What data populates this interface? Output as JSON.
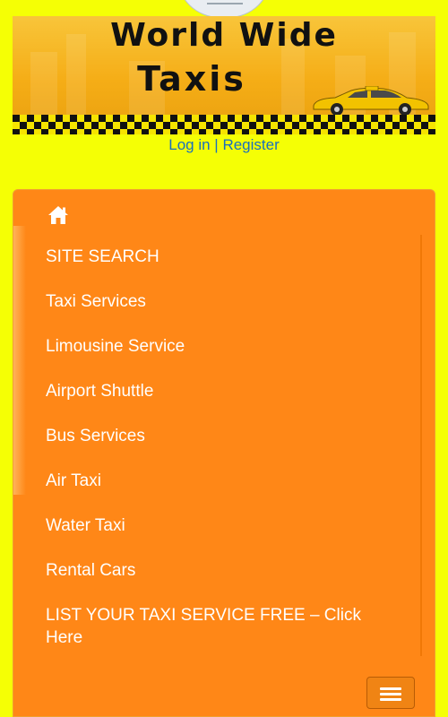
{
  "header": {
    "logo_line1": "World Wide",
    "logo_line2": "Taxis"
  },
  "auth": {
    "login": "Log in",
    "separator": "|",
    "register": "Register"
  },
  "menu": {
    "home_icon": "home-icon",
    "items": [
      {
        "label": "SITE SEARCH"
      },
      {
        "label": "Taxi Services"
      },
      {
        "label": "Limousine Service"
      },
      {
        "label": "Airport Shuttle"
      },
      {
        "label": "Bus Services"
      },
      {
        "label": "Air Taxi"
      },
      {
        "label": "Water Taxi"
      },
      {
        "label": "Rental Cars"
      },
      {
        "label": "LIST YOUR TAXI SERVICE FREE – Click Here"
      }
    ]
  },
  "colors": {
    "page_background": "#f5ff05",
    "menu_background": "#ff8717",
    "link": "#1a6fbd",
    "menu_text": "#ffffff"
  },
  "toggle": {
    "icon": "hamburger-menu-icon"
  }
}
